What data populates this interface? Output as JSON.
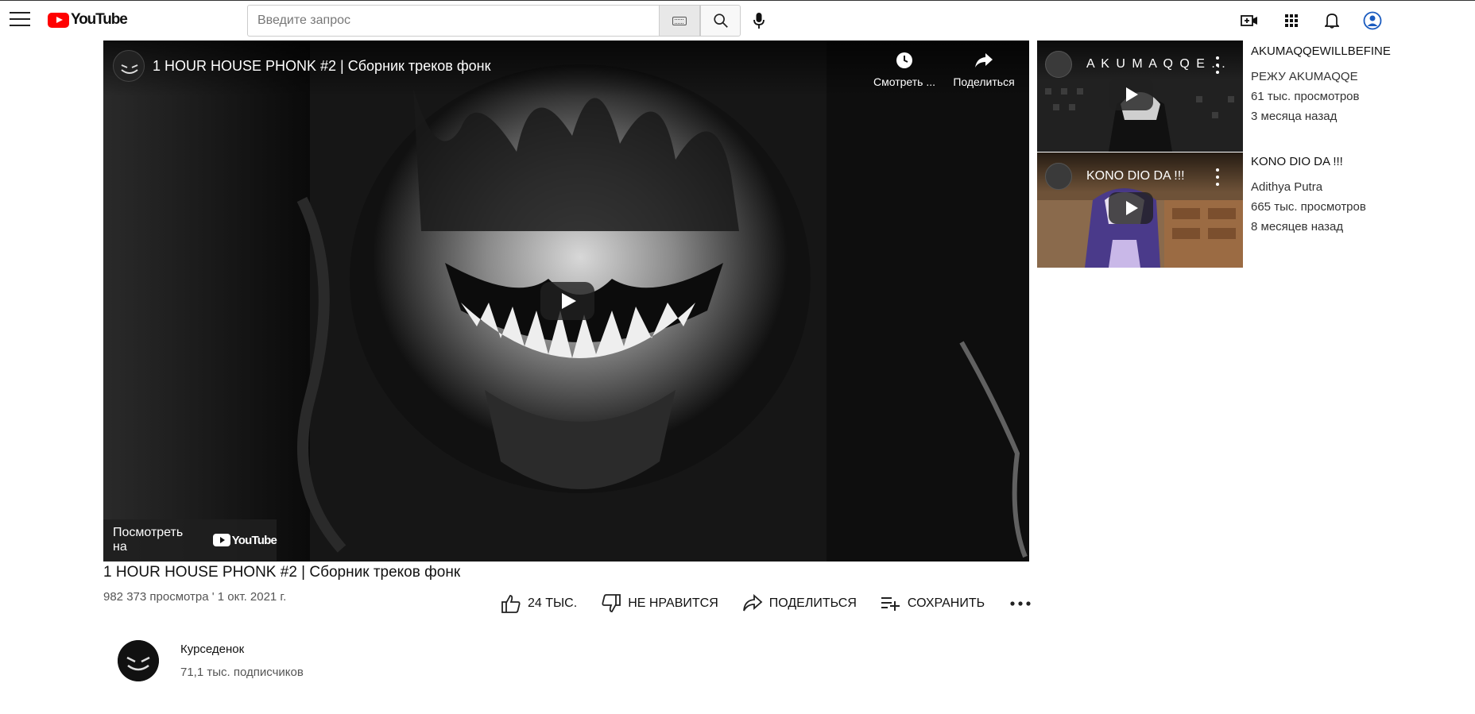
{
  "header": {
    "logo_text": "YouTube",
    "search_placeholder": "Введите запрос"
  },
  "player": {
    "title": "1 HOUR HOUSE PHONK #2 | Сборник треков фонк",
    "watch_later_label": "Смотреть ...",
    "share_label": "Поделиться",
    "watch_on_label": "Посмотреть на",
    "watch_on_logo": "YouTube"
  },
  "video": {
    "title": "1 HOUR HOUSE PHONK #2 | Сборник треков фонк",
    "meta": "982 373 просмотра ' 1 окт. 2021 г.",
    "like_label": "24 ТЫС.",
    "dislike_label": "НЕ НРАВИТСЯ",
    "share_label": "ПОДЕЛИТЬСЯ",
    "save_label": "СОХРАНИТЬ"
  },
  "channel": {
    "name": "Курседенок",
    "subscribers": "71,1 тыс. подписчиков"
  },
  "sidebar": {
    "items": [
      {
        "thumb_title": "A K U M A Q Q E ...",
        "title": "AKUMAQQEWILLBEFINE",
        "channel": "РЕЖУ AKUMAQQE",
        "views": "61 тыс. просмотров",
        "age": "3 месяца назад"
      },
      {
        "thumb_title": "KONO DIO DA !!!",
        "title": "KONO DIO DA !!!",
        "channel": "Adithya Putra",
        "views": "665 тыс. просмотров",
        "age": "8 месяцев назад"
      }
    ]
  },
  "colors": {
    "brand_red": "#ff0000",
    "text_primary": "#0f0f0f",
    "text_secondary": "#555555"
  }
}
